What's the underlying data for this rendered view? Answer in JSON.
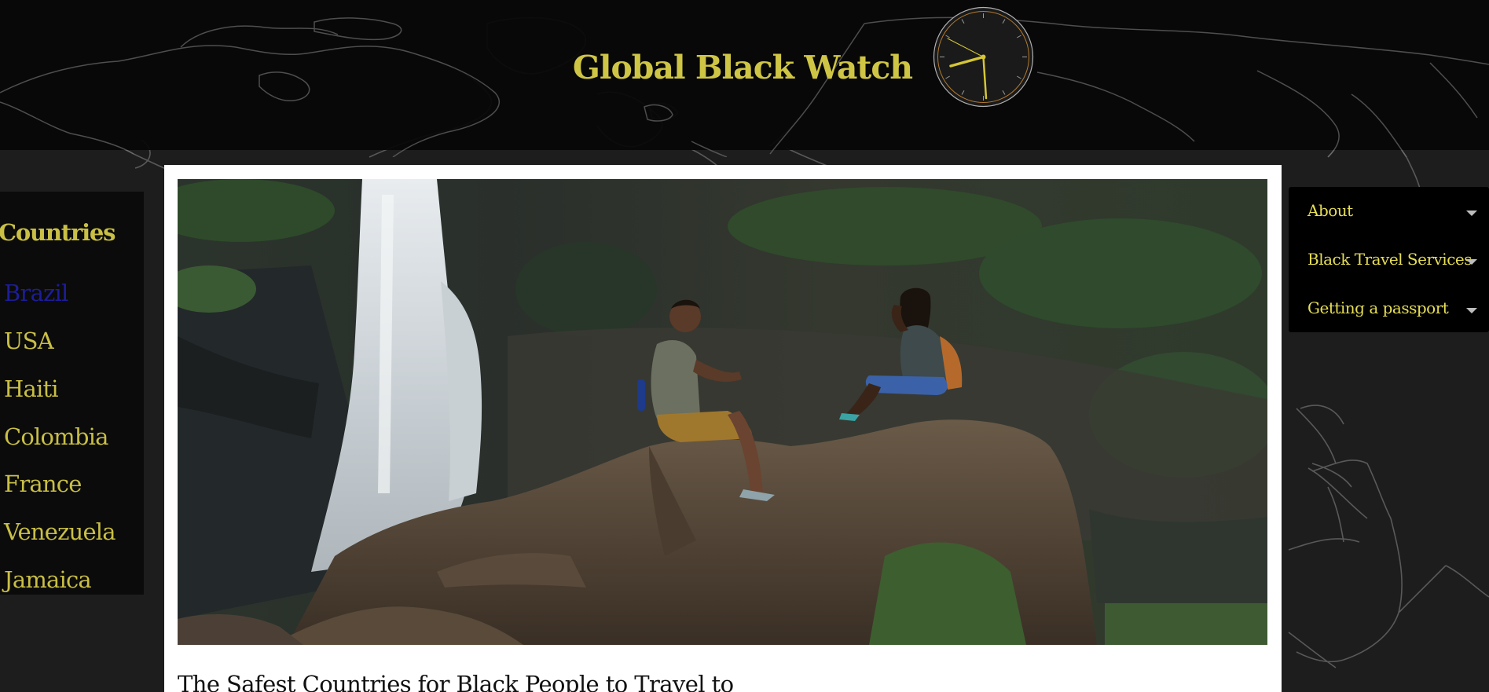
{
  "header": {
    "site_title": "Global Black Watch",
    "clock_icon": "analog-clock-icon"
  },
  "sidebar": {
    "title": "Countries",
    "countries": [
      {
        "label": "Brazil",
        "visited": true
      },
      {
        "label": "USA",
        "visited": false
      },
      {
        "label": "Haiti",
        "visited": false
      },
      {
        "label": "Colombia",
        "visited": false
      },
      {
        "label": "France",
        "visited": false
      },
      {
        "label": "Venezuela",
        "visited": false
      },
      {
        "label": "Jamaica",
        "visited": false
      }
    ]
  },
  "main": {
    "hero_image": "waterfall-travelers-photo",
    "article_title": "The Safest Countries for Black People to Travel to"
  },
  "menu": {
    "items": [
      {
        "label": "About",
        "icon": "caret-down-icon"
      },
      {
        "label": "Black Travel Services",
        "icon": "caret-down-icon"
      },
      {
        "label": "Getting a passport",
        "icon": "caret-down-icon"
      }
    ]
  },
  "colors": {
    "accent_gold": "#cfc545",
    "menu_text": "#e6de56",
    "visited_link": "#1d1d9a",
    "background": "#1d1d1d",
    "header_bg": "#060606"
  }
}
